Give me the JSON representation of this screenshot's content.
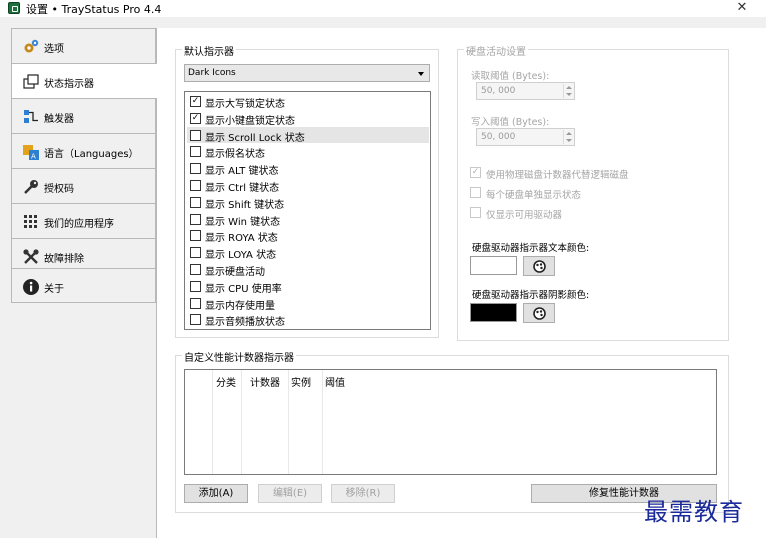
{
  "titlebar": {
    "title": "设置 • TrayStatus Pro 4.4",
    "close_glyph": "✕"
  },
  "sidebar": {
    "tabs": [
      {
        "label": "选项",
        "icon": "gears-icon"
      },
      {
        "label": "状态指示器",
        "icon": "windows-icon"
      },
      {
        "label": "触发器",
        "icon": "trigger-icon"
      },
      {
        "label": "语言（Languages）",
        "icon": "language-icon"
      },
      {
        "label": "授权码",
        "icon": "key-icon"
      },
      {
        "label": "我们的应用程序",
        "icon": "apps-icon"
      },
      {
        "label": "故障排除",
        "icon": "tools-icon"
      },
      {
        "label": "关于",
        "icon": "info-icon"
      }
    ],
    "active": "状态指示器"
  },
  "default_indicator": {
    "group_label": "默认指示器",
    "theme_select": "Dark Icons",
    "items": [
      {
        "label": "显示大写锁定状态",
        "checked": true
      },
      {
        "label": "显示小键盘锁定状态",
        "checked": true
      },
      {
        "label": "显示 Scroll Lock 状态",
        "checked": false,
        "selected": true
      },
      {
        "label": "显示假名状态",
        "checked": false
      },
      {
        "label": "显示 ALT 键状态",
        "checked": false
      },
      {
        "label": "显示 Ctrl 键状态",
        "checked": false
      },
      {
        "label": "显示 Shift 键状态",
        "checked": false
      },
      {
        "label": "显示 Win 键状态",
        "checked": false
      },
      {
        "label": "显示 ROYA 状态",
        "checked": false
      },
      {
        "label": "显示 LOYA 状态",
        "checked": false
      },
      {
        "label": "显示硬盘活动",
        "checked": false
      },
      {
        "label": "显示 CPU 使用率",
        "checked": false
      },
      {
        "label": "显示内存使用量",
        "checked": false
      },
      {
        "label": "显示音频播放状态",
        "checked": false
      }
    ]
  },
  "disk_activity": {
    "group_label": "硬盘活动设置",
    "read_label": "读取阈值 (Bytes):",
    "read_value": "50, 000",
    "write_label": "写入阈值 (Bytes):",
    "write_value": "50, 000",
    "option1": "使用物理磁盘计数器代替逻辑磁盘",
    "option1_checked": true,
    "option2": "每个硬盘单独显示状态",
    "option2_checked": false,
    "option3": "仅显示可用驱动器",
    "option3_checked": false,
    "text_color_label": "硬盘驱动器指示器文本颜色:",
    "text_color": "#ffffff",
    "shadow_color_label": "硬盘驱动器指示器阴影颜色:",
    "shadow_color": "#000000"
  },
  "custom_counters": {
    "group_label": "自定义性能计数器指示器",
    "columns": [
      "分类",
      "计数器",
      "实例",
      "阈值"
    ],
    "rows": [],
    "add_button": "添加(A)",
    "edit_button": "编辑(E)",
    "remove_button": "移除(R)",
    "repair_button": "修复性能计数器"
  },
  "watermark": "最需教育"
}
